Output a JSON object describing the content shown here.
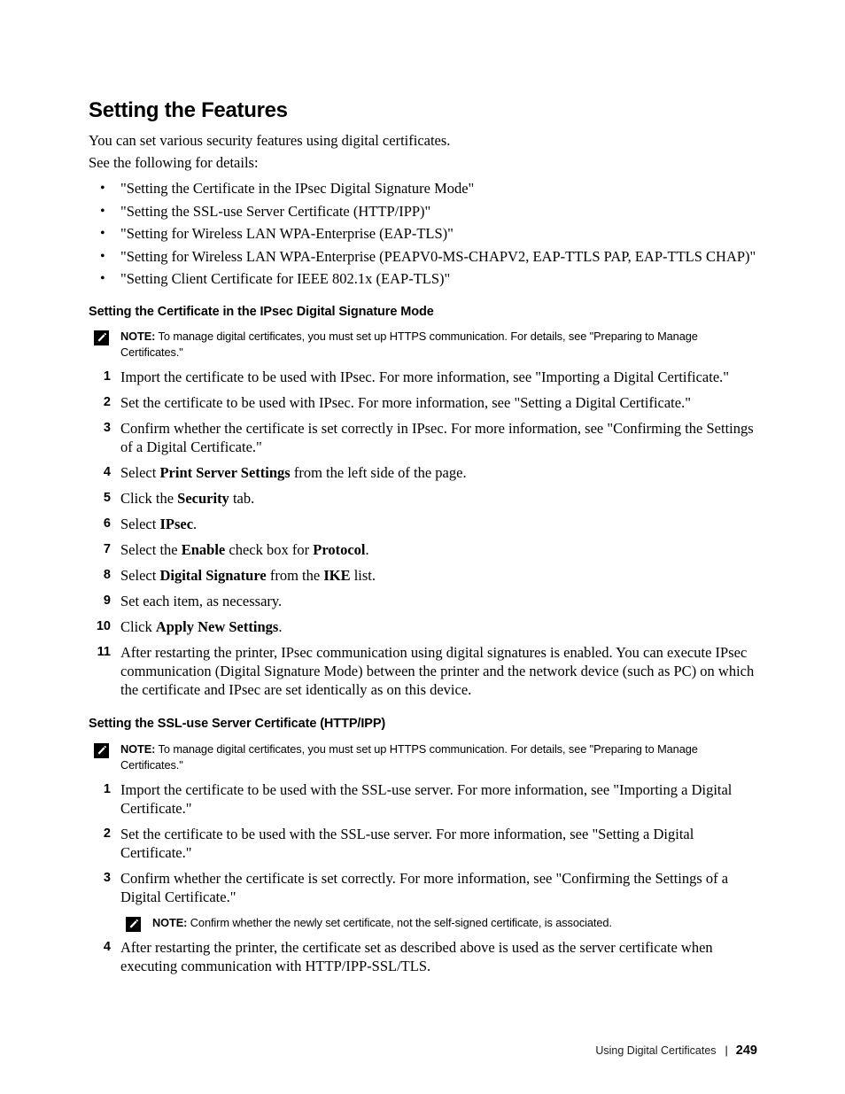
{
  "document": {
    "title": "Setting the Features",
    "intro_lines": [
      "You can set various security features using digital certificates.",
      "See the following for details:"
    ],
    "bullet_marker": "•",
    "bullets": [
      "\"Setting the Certificate in the IPsec Digital Signature Mode\"",
      "\"Setting the SSL-use Server Certificate (HTTP/IPP)\"",
      "\"Setting for Wireless LAN WPA-Enterprise (EAP-TLS)\"",
      "\"Setting for Wireless LAN WPA-Enterprise (PEAPV0-MS-CHAPV2, EAP-TTLS PAP, EAP-TTLS CHAP)\"",
      "\"Setting Client Certificate for IEEE 802.1x (EAP-TLS)\""
    ]
  },
  "note_label": "NOTE:",
  "section1": {
    "heading": "Setting the Certificate in the IPsec Digital Signature Mode",
    "note": "To manage digital certificates, you must set up HTTPS communication. For details, see \"Preparing to Manage Certificates.\"",
    "steps": [
      {
        "num": "1",
        "text": "Import the certificate to be used with IPsec. For more information, see \"Importing a Digital Certificate.\""
      },
      {
        "num": "2",
        "text": "Set the certificate to be used with IPsec. For more information, see \"Setting a Digital Certificate.\""
      },
      {
        "num": "3",
        "text": "Confirm whether the certificate is set correctly in IPsec. For more information, see \"Confirming the Settings of a Digital Certificate.\""
      },
      {
        "num": "4",
        "pre": "Select ",
        "bold": "Print Server Settings",
        "post": " from the left side of the page."
      },
      {
        "num": "5",
        "pre": "Click the ",
        "bold": "Security",
        "post": " tab."
      },
      {
        "num": "6",
        "pre": "Select ",
        "bold": "IPsec",
        "post": "."
      },
      {
        "num": "7",
        "pre": "Select the ",
        "bold": "Enable",
        "mid": " check box for ",
        "bold2": "Protocol",
        "post": "."
      },
      {
        "num": "8",
        "pre": "Select ",
        "bold": "Digital Signature",
        "mid": " from the ",
        "bold2": "IKE",
        "post": " list."
      },
      {
        "num": "9",
        "text": "Set each item, as necessary."
      },
      {
        "num": "10",
        "pre": "Click ",
        "bold": "Apply New Settings",
        "post": "."
      },
      {
        "num": "11",
        "text": "After restarting the printer, IPsec communication using digital signatures is enabled. You can execute IPsec communication (Digital Signature Mode) between the printer and the network device (such as PC) on which the certificate and IPsec are set identically as on this device."
      }
    ]
  },
  "section2": {
    "heading": "Setting the SSL-use Server Certificate (HTTP/IPP)",
    "note": "To manage digital certificates, you must set up HTTPS communication. For details, see \"Preparing to Manage Certificates.\"",
    "steps": [
      {
        "num": "1",
        "text": "Import the certificate to be used with the SSL-use server. For more information, see \"Importing a Digital Certificate.\""
      },
      {
        "num": "2",
        "text": "Set the certificate to be used with the SSL-use server. For more information, see \"Setting a Digital Certificate.\""
      },
      {
        "num": "3",
        "text": "Confirm whether the certificate is set correctly. For more information, see \"Confirming the Settings of a Digital Certificate.\""
      }
    ],
    "inline_note": "Confirm whether the newly set certificate, not the self-signed certificate, is associated.",
    "final_step": {
      "num": "4",
      "text": "After restarting the printer, the certificate set as described above is used as the server certificate when executing communication with HTTP/IPP-SSL/TLS."
    }
  },
  "footer": {
    "chapter": "Using Digital Certificates",
    "separator": "|",
    "page_number": "249"
  }
}
